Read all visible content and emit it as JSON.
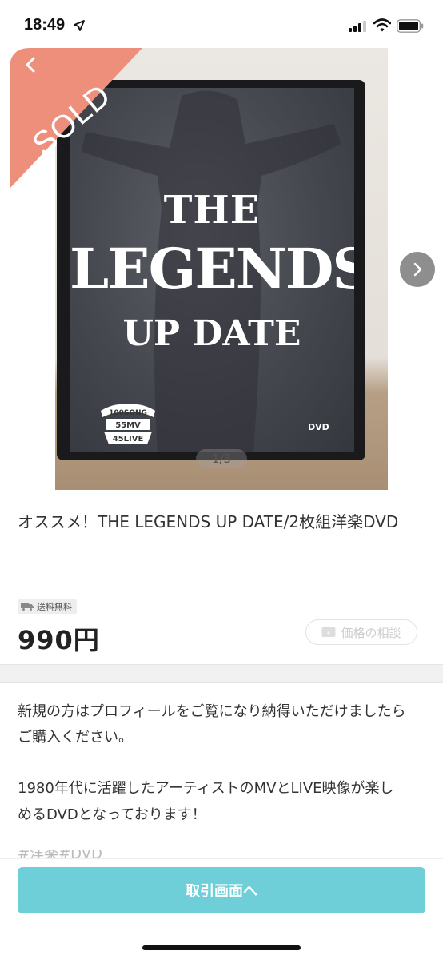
{
  "status_bar": {
    "time": "18:49",
    "icons": [
      "location-arrow-icon",
      "cellular-signal-icon",
      "wifi-icon",
      "battery-icon"
    ]
  },
  "gallery": {
    "sold_label": "SOLD",
    "page_indicator": "1/3",
    "cover": {
      "line1": "THE",
      "line2": "LEGENDS",
      "line3": "UP DATE",
      "emblem_line1": "100SONG",
      "emblem_line2": "55MV",
      "emblem_line3": "45LIVE",
      "dvd_logo": "DVD"
    },
    "icons": [
      "back-chevron-icon",
      "next-arrow-icon"
    ]
  },
  "item": {
    "title": "オススメ！THE LEGENDS UP DATE/2枚組洋楽DVD",
    "shipping_badge": "送料無料",
    "price": "990円",
    "negotiate_label": "価格の相談"
  },
  "description": {
    "line1": "新規の方はプロフィールをご覧になり納得いただけましたら",
    "line2": "ご購入ください。",
    "line3": "1980年代に活躍したアーティストのMVとLIVE映像が楽し",
    "line4": "めるDVDとなっております！",
    "cut_line": "#洋楽#DVD"
  },
  "bottom": {
    "trade_button": "取引画面へ"
  },
  "colors": {
    "sold_ribbon": "#ee8f7c",
    "trade_button": "#6fcfd8",
    "next_button": "#8e8e8e"
  }
}
